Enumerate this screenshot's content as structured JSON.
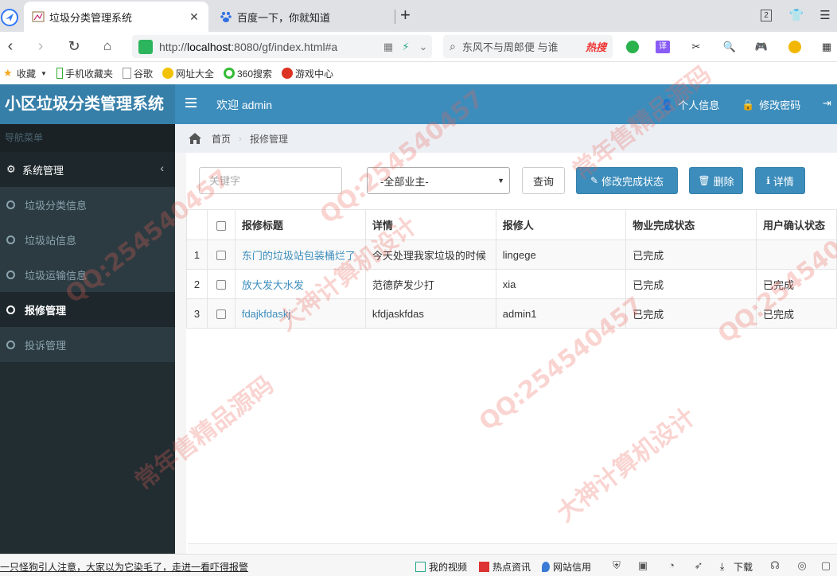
{
  "browser": {
    "tabs": [
      {
        "title": "垃圾分类管理系统",
        "active": true
      },
      {
        "title": "百度一下，你就知道",
        "active": false
      }
    ],
    "tab_count": "2",
    "url_prefix": "http://",
    "url_host": "localhost",
    "url_rest": ":8080/gf/index.html#a",
    "search_text": "东风不与周郎便 与谁",
    "search_hot": "热搜",
    "bookmarks": [
      "收藏",
      "手机收藏夹",
      "谷歌",
      "网址大全",
      "360搜索",
      "游戏中心"
    ]
  },
  "app": {
    "brand": "小区垃圾分类管理系统",
    "welcome": "欢迎 admin",
    "header_links": {
      "profile": "个人信息",
      "password": "修改密码"
    }
  },
  "sidebar": {
    "heading": "导航菜单",
    "group": "系统管理",
    "items": [
      {
        "label": "垃圾分类信息",
        "active": false
      },
      {
        "label": "垃圾站信息",
        "active": false
      },
      {
        "label": "垃圾运输信息",
        "active": false
      },
      {
        "label": "报修管理",
        "active": true
      },
      {
        "label": "投诉管理",
        "active": false
      }
    ]
  },
  "breadcrumb": {
    "home": "首页",
    "current": "报修管理"
  },
  "toolbar": {
    "keyword_placeholder": "关键字",
    "owner_select": "-全部业主-",
    "query": "查询",
    "modify_status": "修改完成状态",
    "delete": "删除",
    "detail": "详情"
  },
  "table": {
    "columns": [
      "报修标题",
      "详情",
      "报修人",
      "物业完成状态",
      "用户确认状态"
    ],
    "rows": [
      {
        "no": "1",
        "title": "东门的垃圾站包装桶烂了",
        "detail": "今天处理我家垃圾的时候",
        "reporter": "lingege",
        "property_status": "已完成",
        "user_status": ""
      },
      {
        "no": "2",
        "title": "放大发大水发",
        "detail": "范德萨发少打",
        "reporter": "xia",
        "property_status": "已完成",
        "user_status": "已完成"
      },
      {
        "no": "3",
        "title": "fdajkfdaskj",
        "detail": "kfdjaskfdas",
        "reporter": "admin1",
        "property_status": "已完成",
        "user_status": "已完成"
      }
    ]
  },
  "statusbar": {
    "news": "一只怪狗引人注意，大家以为它染毛了，走进一看吓得报警",
    "links": [
      "我的视频",
      "热点资讯",
      "网站信用"
    ],
    "download": "下载"
  },
  "watermark_texts": [
    "QQ:254540457",
    "大神计算机设计",
    "常年售精品源码"
  ],
  "colors": {
    "header": "#3c8dbc",
    "brand_bg": "#367fa9",
    "sidebar": "#222d32",
    "accent": "#3c8dbc"
  }
}
